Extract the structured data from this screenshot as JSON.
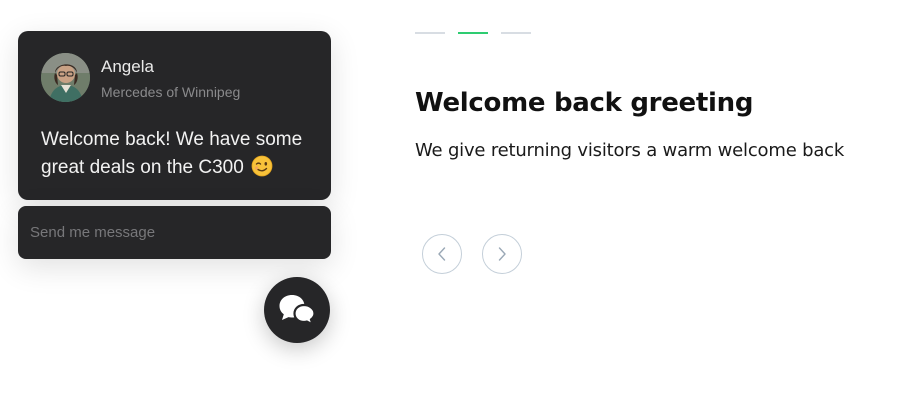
{
  "chat": {
    "agent_name": "Angela",
    "agent_company": "Mercedes of Winnipeg",
    "message": "Welcome back! We have some great deals on the C300",
    "message_emoji": "winking-face-icon",
    "input_placeholder": "Send me message"
  },
  "launcher": {
    "icon": "chat-bubbles-icon"
  },
  "slides": {
    "count": 3,
    "active_index": 1,
    "active_color": "#2ecc71",
    "inactive_color": "#d8dde3"
  },
  "feature": {
    "title": "Welcome back greeting",
    "description": "We give returning visitors a warm welcome back"
  },
  "nav": {
    "prev_icon": "chevron-left-icon",
    "next_icon": "chevron-right-icon"
  },
  "colors": {
    "card_background": "#262628",
    "accent": "#2ecc71"
  }
}
